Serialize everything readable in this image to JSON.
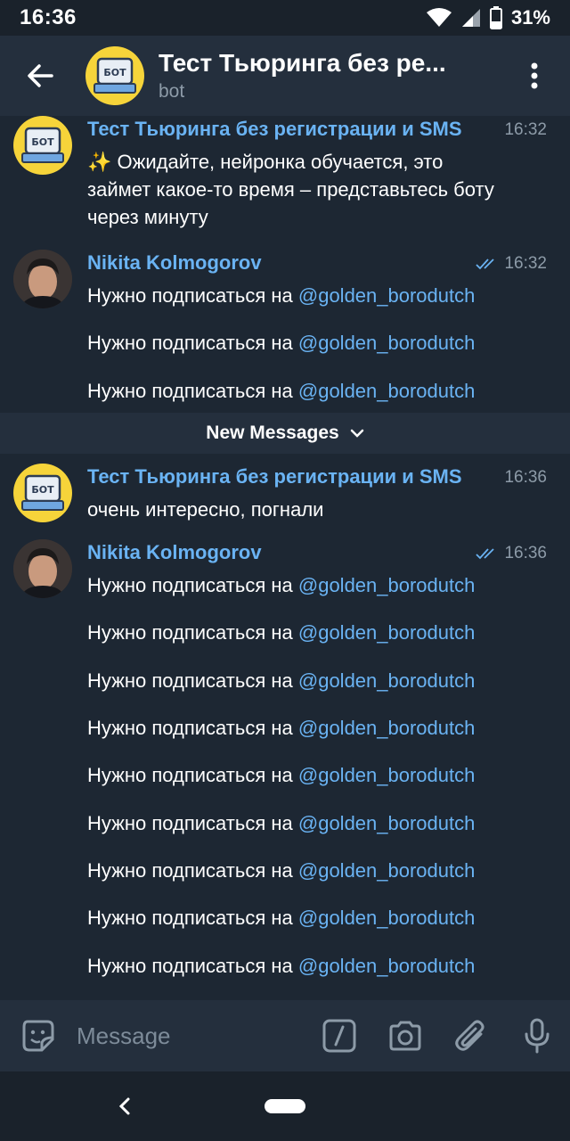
{
  "status": {
    "time": "16:36",
    "battery": "31%"
  },
  "header": {
    "title": "Тест Тьюринга без ре...",
    "subtitle": "bot",
    "avatar_label": "БОТ"
  },
  "messages": [
    {
      "sender": "Тест Тьюринга без регистрации и SMS",
      "time": "16:32",
      "lines": [
        "✨ Ожидайте, нейронка обучается, это займет какое-то время – представьтесь боту через минуту"
      ]
    },
    {
      "sender": "Nikita Kolmogorov",
      "time": "16:32",
      "prefix": "Нужно подписаться на ",
      "mention": "@golden_borodutch",
      "count": 3
    },
    {
      "sender": "Тест Тьюринга без регистрации и SMS",
      "time": "16:36",
      "lines": [
        "очень интересно, погнали"
      ]
    },
    {
      "sender": "Nikita Kolmogorov",
      "time": "16:36",
      "prefix": "Нужно подписаться на ",
      "mention": "@golden_borodutch",
      "count": 9
    }
  ],
  "new_messages_label": "New Messages",
  "input": {
    "placeholder": "Message"
  },
  "colors": {
    "accent": "#6ab3f3",
    "background": "#1d2733",
    "header": "#242f3d"
  },
  "icons": [
    "back-arrow-icon",
    "menu-dots-icon",
    "sticker-icon",
    "bot-command-icon",
    "camera-icon",
    "attach-icon",
    "mic-icon",
    "read-checks-icon"
  ]
}
